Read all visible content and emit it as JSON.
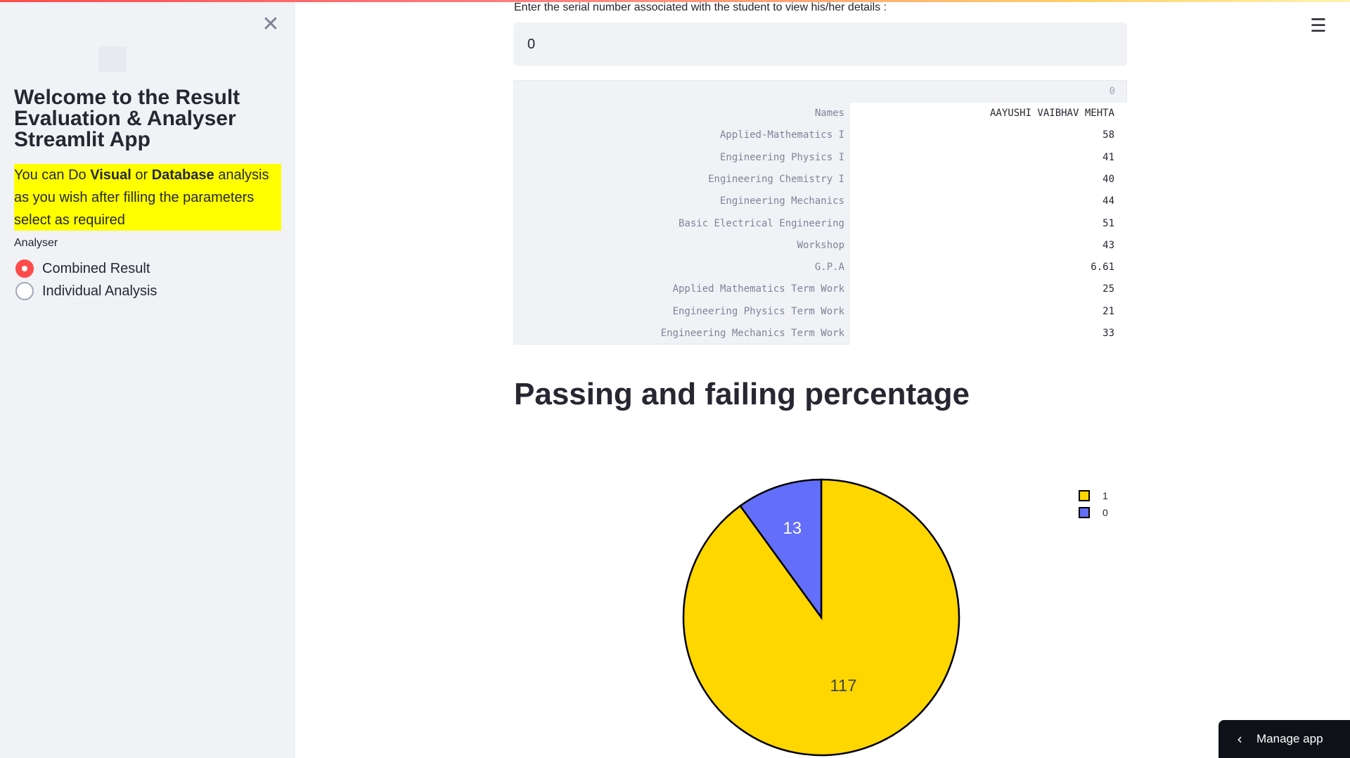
{
  "sidebar": {
    "close_glyph": "✕",
    "title": "Welcome to the Result Evaluation & Analyser Streamlit App",
    "info": {
      "part1": "You can Do ",
      "bold1": "Visual",
      "part2": " or ",
      "bold2": "Database",
      "part3": " analysis as you wish after filling the parameters select as required"
    },
    "radio_label": "Analyser",
    "options": [
      {
        "label": "Combined Result",
        "selected": true
      },
      {
        "label": "Individual Analysis",
        "selected": false
      }
    ]
  },
  "main": {
    "menu_glyph": "☰",
    "input_label": "Enter the serial number associated with the student to view his/her details :",
    "input_value": "0",
    "dataframe": {
      "column": "0",
      "rows": [
        {
          "index": "Names",
          "value": "AAYUSHI VAIBHAV MEHTA"
        },
        {
          "index": "Applied-Mathematics I",
          "value": "58"
        },
        {
          "index": "Engineering Physics I",
          "value": "41"
        },
        {
          "index": "Engineering Chemistry I",
          "value": "40"
        },
        {
          "index": "Engineering Mechanics",
          "value": "44"
        },
        {
          "index": "Basic Electrical Engineering",
          "value": "51"
        },
        {
          "index": "Workshop",
          "value": "43"
        },
        {
          "index": "G.P.A",
          "value": "6.61"
        },
        {
          "index": "Applied Mathematics Term Work",
          "value": "25"
        },
        {
          "index": "Engineering Physics Term Work",
          "value": "21"
        },
        {
          "index": "Engineering Mechanics Term Work",
          "value": "33"
        }
      ]
    },
    "section_title": "Passing and failing percentage",
    "manage_app": {
      "label": "Manage app",
      "chevron": "‹"
    }
  },
  "chart_data": {
    "type": "pie",
    "title": "",
    "labels": [
      "1",
      "0"
    ],
    "values": [
      117,
      13
    ],
    "colors": [
      "#ffd700",
      "#636efa"
    ],
    "legend": "top-right"
  }
}
